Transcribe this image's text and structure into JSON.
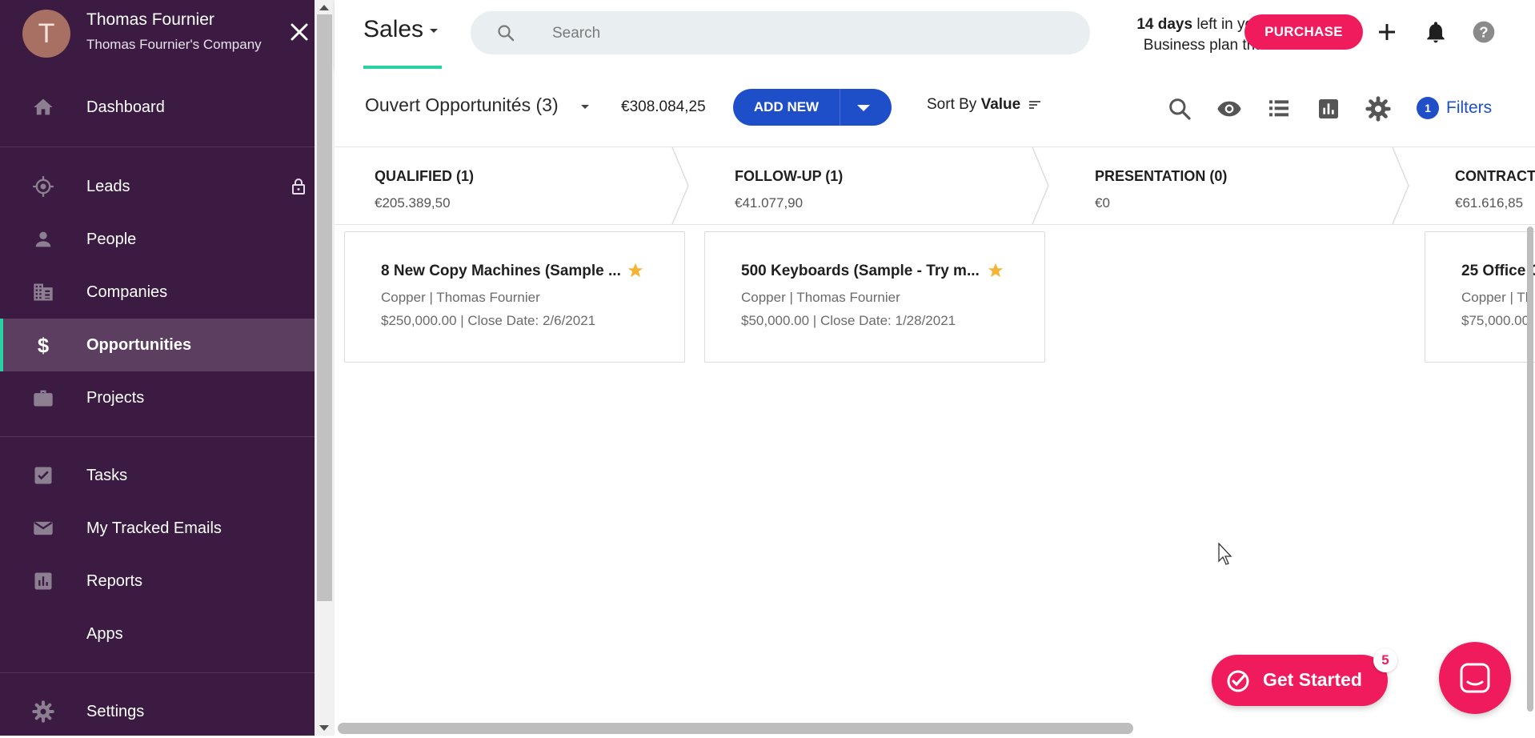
{
  "profile": {
    "initial": "T",
    "name": "Thomas Fournier",
    "company": "Thomas Fournier's Company"
  },
  "sidebar": {
    "items": [
      {
        "label": "Dashboard",
        "icon": "home-icon"
      },
      {
        "label": "Leads",
        "icon": "target-icon",
        "locked": true
      },
      {
        "label": "People",
        "icon": "person-icon"
      },
      {
        "label": "Companies",
        "icon": "building-icon"
      },
      {
        "label": "Opportunities",
        "icon": "dollar-icon",
        "active": true
      },
      {
        "label": "Projects",
        "icon": "briefcase-icon"
      },
      {
        "label": "Tasks",
        "icon": "checkbox-icon"
      },
      {
        "label": "My Tracked Emails",
        "icon": "envelope-icon"
      },
      {
        "label": "Reports",
        "icon": "bar-chart-icon"
      },
      {
        "label": "Apps",
        "icon": "grid-icon"
      },
      {
        "label": "Settings",
        "icon": "gear-icon"
      }
    ]
  },
  "header": {
    "app_title": "Sales",
    "search_placeholder": "Search",
    "trial_days": "14 days",
    "trial_rest_line1": " left in your",
    "trial_line2": "Business plan trial",
    "purchase_label": "PURCHASE"
  },
  "toolbar": {
    "view_title": "Ouvert Opportunités (3)",
    "total_value": "€308.084,25",
    "add_new_label": "ADD NEW",
    "sort_prefix": "Sort By ",
    "sort_value": "Value",
    "filters_count": "1",
    "filters_label": "Filters"
  },
  "stages": [
    {
      "name": "QUALIFIED (1)",
      "value": "€205.389,50"
    },
    {
      "name": "FOLLOW-UP (1)",
      "value": "€41.077,90"
    },
    {
      "name": "PRESENTATION (0)",
      "value": "€0"
    },
    {
      "name": "CONTRACT",
      "value": "€61.616,85"
    }
  ],
  "cards": [
    {
      "title": "8 New Copy Machines (Sample ...",
      "sub": "Copper | Thomas Fournier",
      "meta": "$250,000.00 | Close Date: 2/6/2021",
      "starred": true
    },
    {
      "title": "500 Keyboards (Sample - Try m...",
      "sub": "Copper | Thomas Fournier",
      "meta": "$50,000.00 | Close Date: 1/28/2021",
      "starred": true
    },
    {
      "title": "25 Office C",
      "sub": "Copper | Th",
      "meta": "$75,000.00"
    }
  ],
  "get_started": {
    "label": "Get Started",
    "badge": "5"
  },
  "colors": {
    "sidebar_bg": "#3b1b41",
    "accent_green": "#2ad1a5",
    "brand_pink": "#f01b5c",
    "primary_blue": "#1f4fc8"
  }
}
